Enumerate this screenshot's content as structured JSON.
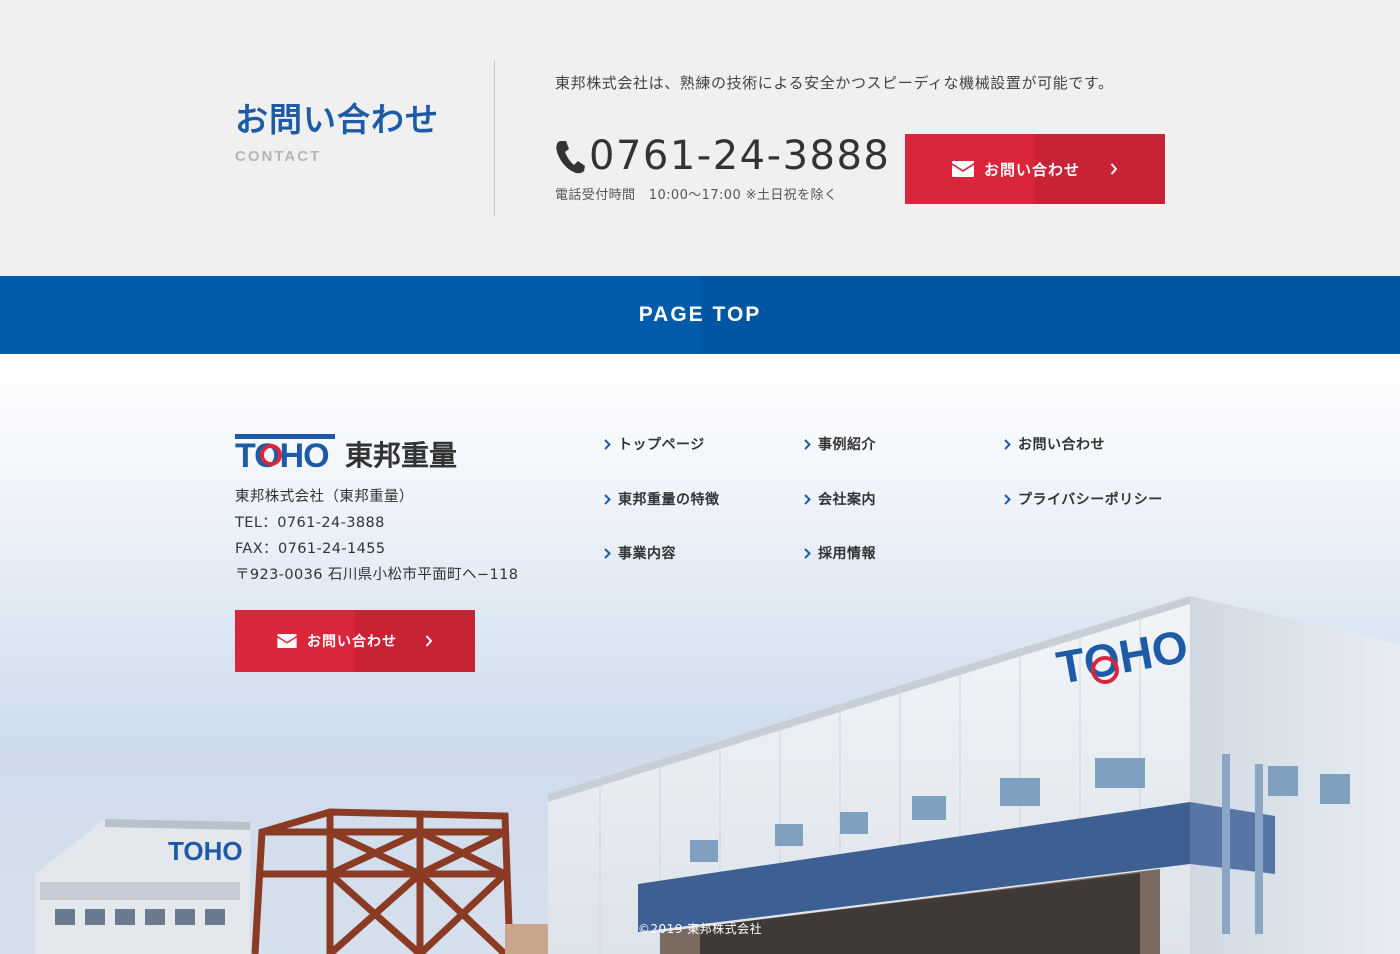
{
  "contact": {
    "title": "お問い合わせ",
    "subtitle": "CONTACT",
    "description": "東邦株式会社は、熟練の技術による安全かつスピーディな機械設置が可能です。",
    "phone": "0761-24-3888",
    "hours": "電話受付時間　10:00〜17:00 ※土日祝を除く",
    "button_label": "お問い合わせ"
  },
  "pagetop": {
    "label": "PAGE TOP"
  },
  "footer": {
    "logo_text": "TOHO",
    "logo_kanji": "東邦重量",
    "company": "東邦株式会社（東邦重量）",
    "tel": "TEL：0761-24-3888",
    "fax": "FAX：0761-24-1455",
    "address": "〒923-0036 石川県小松市平面町ヘ−118",
    "button_label": "お問い合わせ",
    "nav": [
      {
        "label": "トップページ"
      },
      {
        "label": "事例紹介"
      },
      {
        "label": "お問い合わせ"
      },
      {
        "label": "東邦重量の特徴"
      },
      {
        "label": "会社案内"
      },
      {
        "label": "プライバシーポリシー"
      },
      {
        "label": "事業内容"
      },
      {
        "label": "採用情報"
      }
    ],
    "building_sign": "TOHO",
    "copyright": "©2019 東邦株式会社"
  },
  "colors": {
    "brand_blue": "#005bac",
    "title_blue": "#1d5ba8",
    "button_red": "#d9263a",
    "contact_bg": "#f0f0f0"
  },
  "icons": [
    "phone-icon",
    "mail-icon",
    "chevron-right-icon"
  ]
}
